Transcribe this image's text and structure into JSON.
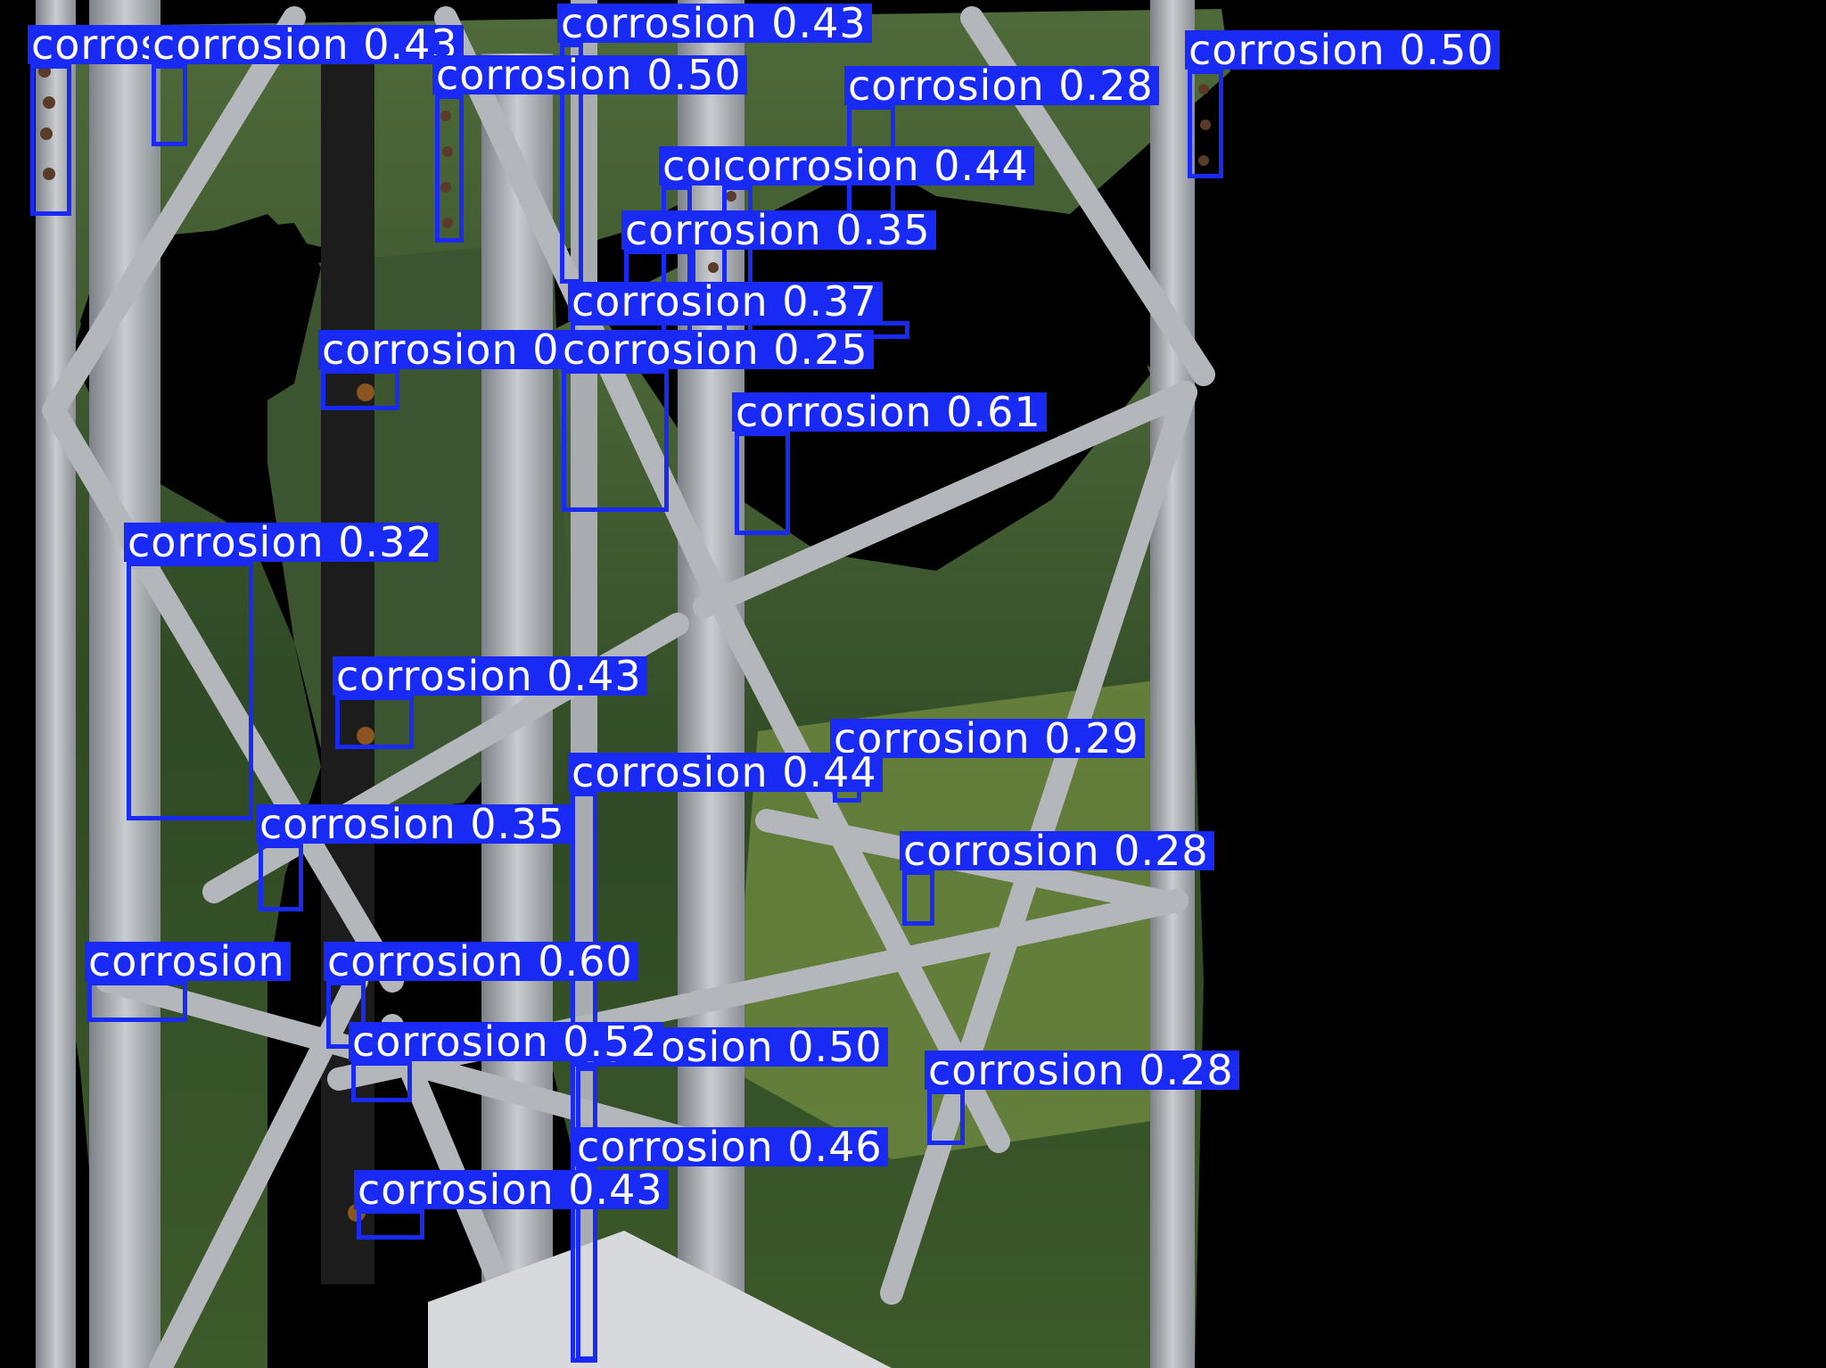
{
  "image": {
    "description_icon": "photo-of-lattice-steel-tower-with-forest-background",
    "colors": {
      "background": "#000000",
      "box": "#1a2af5",
      "label_text": "#ffffff"
    }
  },
  "detections": [
    {
      "label": "corrosion 0.51"
    },
    {
      "label": "corrosion 0.43"
    },
    {
      "label": "corrosion 0.43"
    },
    {
      "label": "corrosion 0.50"
    },
    {
      "label": "corrosion 0.28"
    },
    {
      "label": "corrosion 0.50"
    },
    {
      "label": "corrosion 0.48"
    },
    {
      "label": "corrosion 0.44"
    },
    {
      "label": "corrosion 0.35"
    },
    {
      "label": "corrosion 0.37"
    },
    {
      "label": "corrosion 0.38"
    },
    {
      "label": "corrosion 0.25"
    },
    {
      "label": "corrosion 0.61"
    },
    {
      "label": "corrosion 0.32"
    },
    {
      "label": "corrosion 0.43"
    },
    {
      "label": "corrosion 0.29"
    },
    {
      "label": "corrosion 0.44"
    },
    {
      "label": "corrosion 0.35"
    },
    {
      "label": "corrosion 0.28"
    },
    {
      "label": "corrosion 0.60"
    },
    {
      "label": "corrosion"
    },
    {
      "label": "corrosion 0.50"
    },
    {
      "label": "corrosion 0.52"
    },
    {
      "label": "corrosion 0.28"
    },
    {
      "label": "corrosion 0.46"
    },
    {
      "label": "corrosion 0.43"
    }
  ]
}
